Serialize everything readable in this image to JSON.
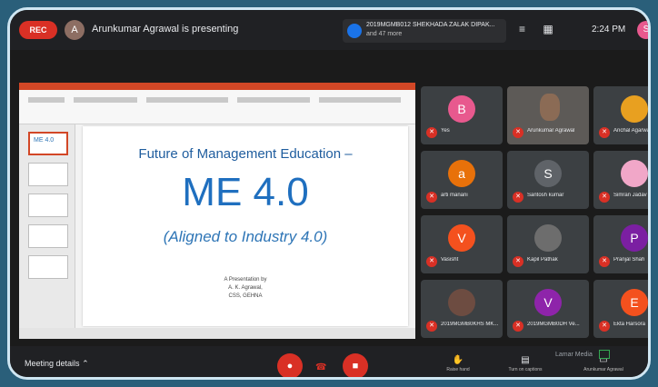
{
  "topbar": {
    "rec_label": "REC",
    "presenter_initial": "A",
    "presenter_text": "Arunkumar Agrawal is presenting",
    "participants_line1": "2019MGMB012 SHEKHADA ZALAK DIPAK...",
    "participants_line2": "and 47 more",
    "clock": "2:24 PM",
    "self_initial": "S"
  },
  "slide": {
    "title": "Future of Management Education –",
    "big": "ME 4.0",
    "subtitle": "(Aligned to Industry 4.0)",
    "byline1": "A Presentation by",
    "byline2": "A. K. Agrawal,",
    "byline3": "CSS, GEHNA",
    "thumb_text": "ME 4.0"
  },
  "participants": [
    {
      "initial": "B",
      "name": "Yes",
      "color": "#e8598e"
    },
    {
      "initial": "",
      "name": "Arunkumar Agrawal",
      "color": "#5d5a57",
      "video": true
    },
    {
      "initial": "",
      "name": "Anchal Agarwal",
      "color": "#e8a020"
    },
    {
      "initial": "a",
      "name": "arti manani",
      "color": "#e8710a"
    },
    {
      "initial": "S",
      "name": "Santosh kumar",
      "color": "#5f6368"
    },
    {
      "initial": "",
      "name": "Simran Jadav",
      "color": "#f1a7c8"
    },
    {
      "initial": "V",
      "name": "Vasisht",
      "color": "#f4511e"
    },
    {
      "initial": "",
      "name": "Kapil Pathak",
      "color": "#6d6d6d"
    },
    {
      "initial": "P",
      "name": "Pranjal Shah",
      "color": "#7b1fa2"
    },
    {
      "initial": "",
      "name": "2019MGMB0KHS MK...",
      "color": "#6d4c41"
    },
    {
      "initial": "V",
      "name": "2019MGMB0DH Ve...",
      "color": "#8e24aa"
    },
    {
      "initial": "E",
      "name": "Ekta Harsora",
      "color": "#f4511e"
    }
  ],
  "bottombar": {
    "meeting_details": "Meeting details",
    "raise_hand": "Raise hand",
    "captions": "Turn on captions",
    "presenting": "Arunkumar Agrawal",
    "brand": "Lamar Media"
  },
  "colors": {
    "record": "#d93025",
    "accent": "#1a73e8",
    "bar": "#202124"
  }
}
